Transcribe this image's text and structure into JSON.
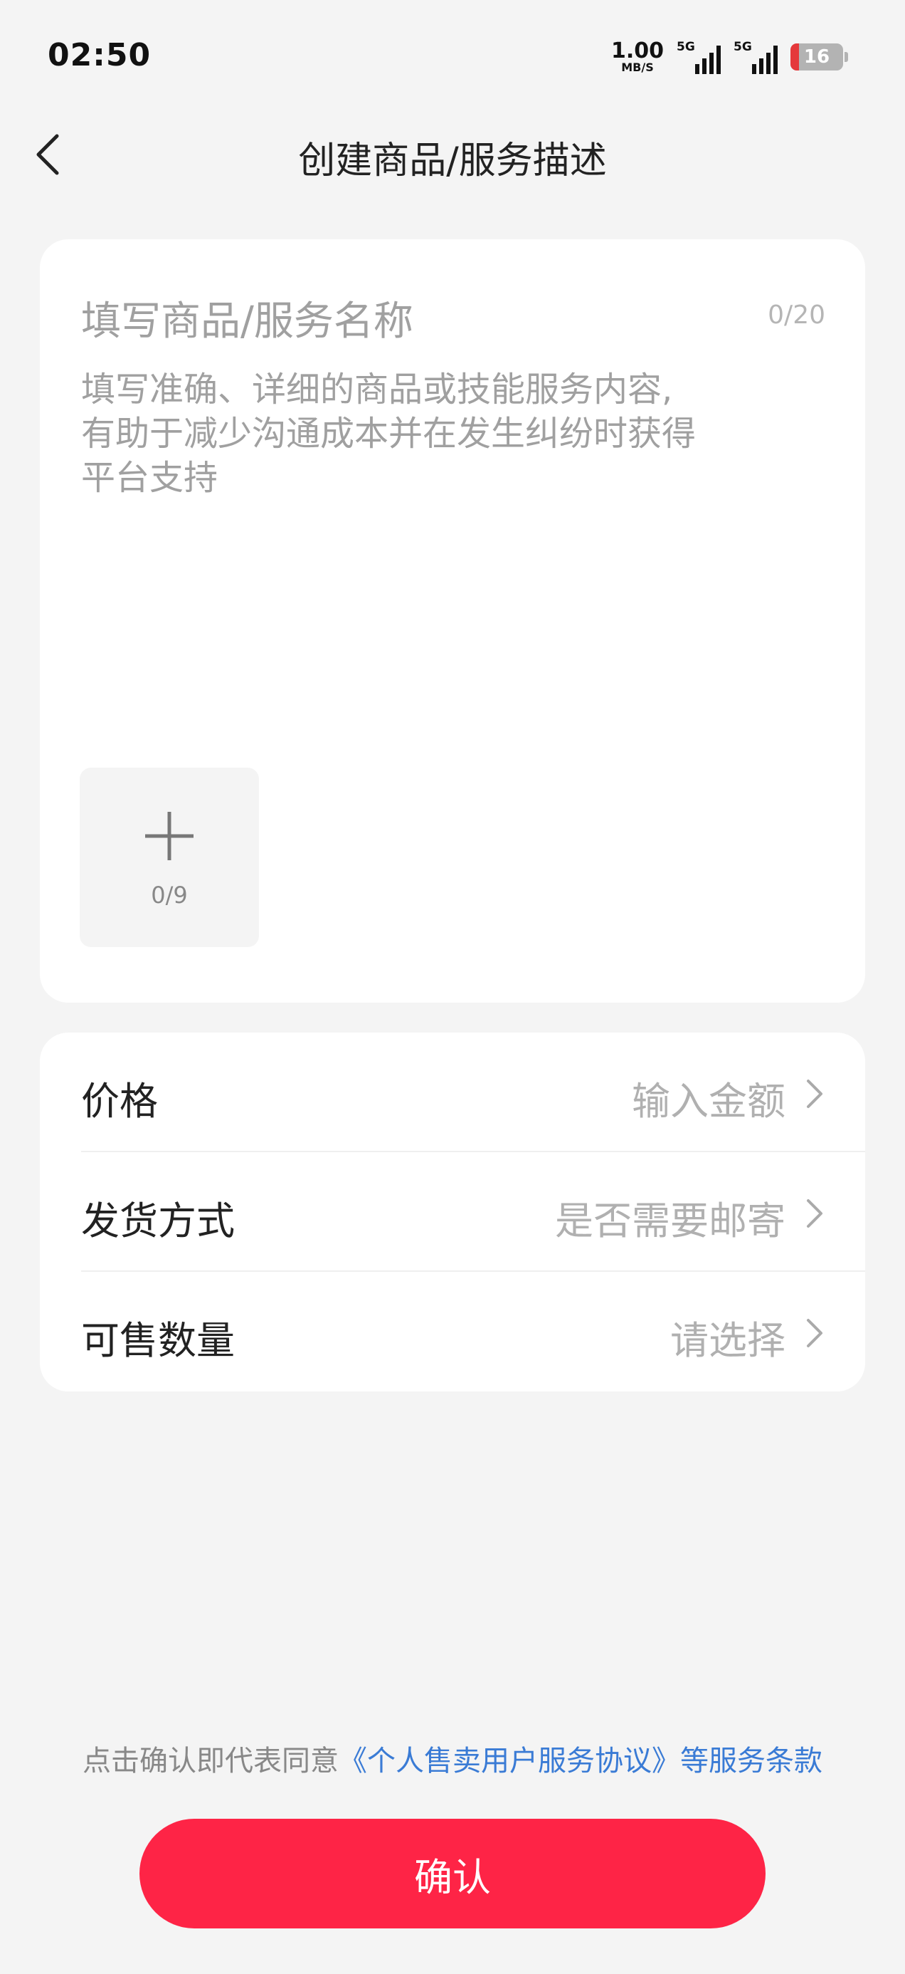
{
  "status_bar": {
    "time": "02:50",
    "net_speed_value": "1.00",
    "net_speed_unit": "MB/S",
    "signal1_label": "5G",
    "signal2_label": "5G",
    "battery_level": "16"
  },
  "nav": {
    "title": "创建商品/服务描述"
  },
  "description_card": {
    "name_placeholder": "填写商品/服务名称",
    "name_counter": "0/20",
    "description_placeholder": "填写准确、详细的商品或技能服务内容,\n有助于减少沟通成本并在发生纠纷时获得\n平台支持",
    "image_counter": "0/9"
  },
  "form": {
    "rows": [
      {
        "label": "价格",
        "value": "输入金额"
      },
      {
        "label": "发货方式",
        "value": "是否需要邮寄"
      },
      {
        "label": "可售数量",
        "value": "请选择"
      }
    ]
  },
  "agreement": {
    "prefix": "点击确认即代表同意",
    "link": "《个人售卖用户服务协议》",
    "suffix": "等服务条款"
  },
  "confirm_label": "确认",
  "colors": {
    "accent": "#fe2446",
    "link": "#3a7bd5",
    "background": "#f4f4f4"
  }
}
